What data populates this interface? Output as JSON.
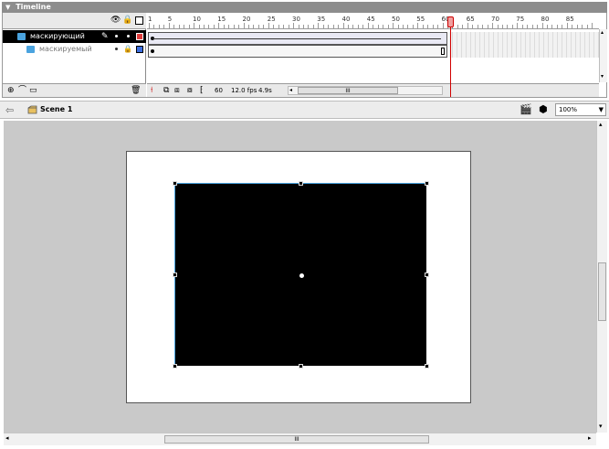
{
  "timeline": {
    "title": "Timeline",
    "layers": [
      {
        "name": "маскирующий",
        "selected": true,
        "icon_color": "#4aa3df",
        "swatch_color": "#e03c3c"
      },
      {
        "name": "маскируемый",
        "selected": false,
        "icon_color": "#4aa3df",
        "swatch_color": "#3c6fe0"
      }
    ],
    "ruler_labels": [
      "1",
      "5",
      "10",
      "15",
      "20",
      "25",
      "30",
      "35",
      "40",
      "45",
      "50",
      "55",
      "60",
      "65",
      "70",
      "75",
      "80",
      "85"
    ],
    "current_frame": "60",
    "frame_rate": "12.0 fps",
    "elapsed_time": "4.9s",
    "scroll_grip": "III"
  },
  "edit_bar": {
    "scene_label": "Scene 1",
    "zoom": "100%"
  },
  "stage": {
    "scroll_grip": "III"
  },
  "colors": {
    "playhead": "#d00000",
    "selected_layer_bg": "#000000",
    "selection_outline": "#4aa3df",
    "work_area": "#c9c9c9",
    "stage": "#ffffff",
    "shape_fill": "#000000"
  }
}
